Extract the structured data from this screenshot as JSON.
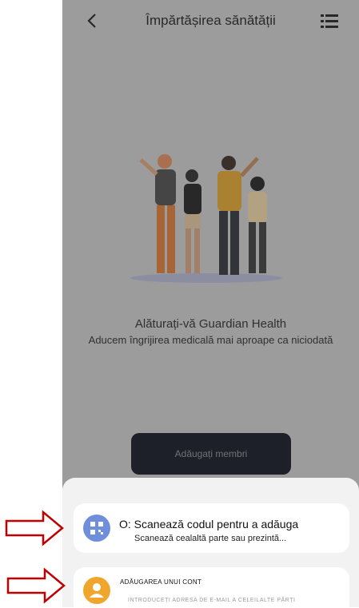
{
  "header": {
    "title": "Împărtășirea sănătății"
  },
  "main": {
    "headline": "Alăturați-vă Guardian Health",
    "tagline": "Aducem îngrijirea medicală mai aproape ca niciodată",
    "add_members_label": "Adăugați membri"
  },
  "sheet": {
    "scan_card": {
      "title": "O: Scanează codul pentru a adăuga",
      "subtitle": "Scanează cealaltă parte sau prezintă..."
    },
    "account_card": {
      "title": "ADĂUGAREA UNUI CONT",
      "subtitle": "INTRODUCEȚI ADRESA DE E-MAIL A CELEILALTE PĂRȚI"
    }
  },
  "icons": {
    "back": "back-arrow-icon",
    "menu": "list-menu-icon",
    "qr": "qr-code-icon",
    "user": "user-avatar-icon",
    "annotation": "red-arrow-icon"
  },
  "colors": {
    "add_button": "#0d1220",
    "qr_icon": "#6f8fdc",
    "user_icon": "#f0a52c",
    "annotation_arrow": "#c00000"
  }
}
